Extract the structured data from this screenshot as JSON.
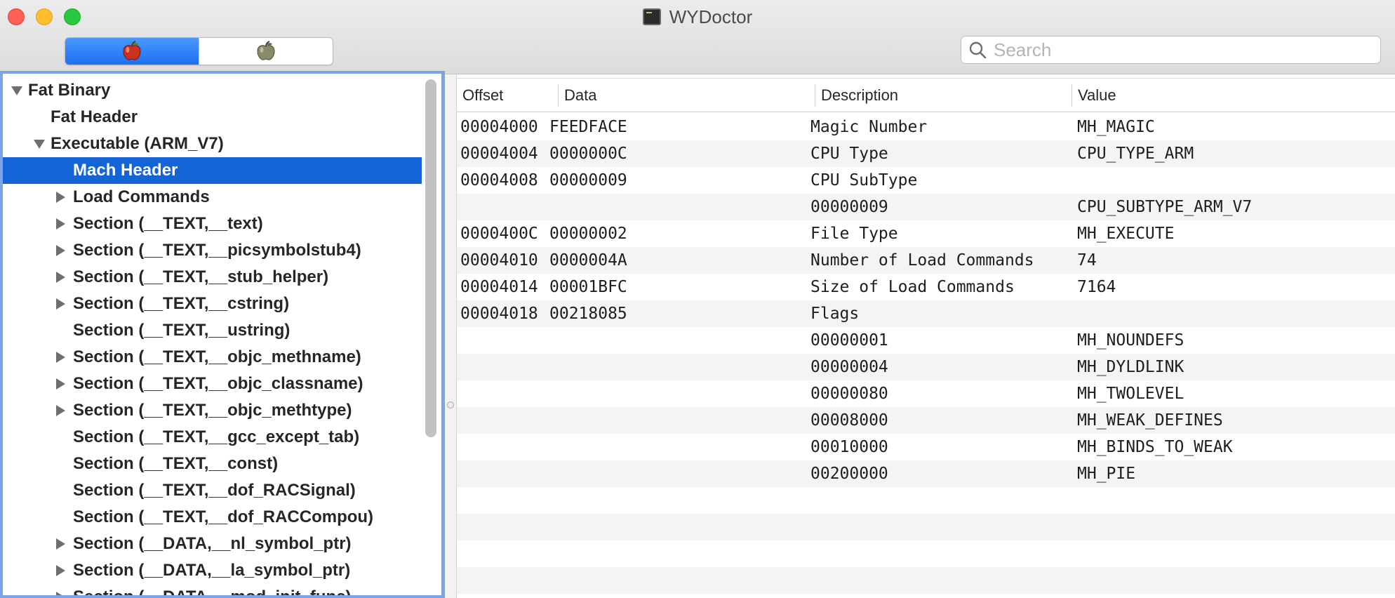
{
  "window": {
    "title": "WYDoctor"
  },
  "search": {
    "placeholder": "Search",
    "value": ""
  },
  "segmented": {
    "items": [
      {
        "icon": "red-apple-icon",
        "selected": true
      },
      {
        "icon": "gray-apple-icon",
        "selected": false
      }
    ]
  },
  "colors": {
    "accent": "#1464d8",
    "segment_active": "#2a7bf4",
    "sidebar_border": "#7aa6e8"
  },
  "tree": {
    "items": [
      {
        "label": "Fat Binary",
        "level": 0,
        "disclosure": "open"
      },
      {
        "label": "Fat Header",
        "level": 1,
        "disclosure": "none"
      },
      {
        "label": "Executable  (ARM_V7)",
        "level": 1,
        "disclosure": "open"
      },
      {
        "label": "Mach Header",
        "level": 2,
        "disclosure": "none",
        "selected": true
      },
      {
        "label": "Load Commands",
        "level": 2,
        "disclosure": "closed"
      },
      {
        "label": "Section (__TEXT,__text)",
        "level": 2,
        "disclosure": "closed"
      },
      {
        "label": "Section (__TEXT,__picsymbolstub4)",
        "level": 2,
        "disclosure": "closed"
      },
      {
        "label": "Section (__TEXT,__stub_helper)",
        "level": 2,
        "disclosure": "closed"
      },
      {
        "label": "Section (__TEXT,__cstring)",
        "level": 2,
        "disclosure": "closed"
      },
      {
        "label": "Section (__TEXT,__ustring)",
        "level": 2,
        "disclosure": "none"
      },
      {
        "label": "Section (__TEXT,__objc_methname)",
        "level": 2,
        "disclosure": "closed"
      },
      {
        "label": "Section (__TEXT,__objc_classname)",
        "level": 2,
        "disclosure": "closed"
      },
      {
        "label": "Section (__TEXT,__objc_methtype)",
        "level": 2,
        "disclosure": "closed"
      },
      {
        "label": "Section (__TEXT,__gcc_except_tab)",
        "level": 2,
        "disclosure": "none"
      },
      {
        "label": "Section (__TEXT,__const)",
        "level": 2,
        "disclosure": "none"
      },
      {
        "label": "Section (__TEXT,__dof_RACSignal)",
        "level": 2,
        "disclosure": "none"
      },
      {
        "label": "Section (__TEXT,__dof_RACCompou)",
        "level": 2,
        "disclosure": "none"
      },
      {
        "label": "Section (__DATA,__nl_symbol_ptr)",
        "level": 2,
        "disclosure": "closed"
      },
      {
        "label": "Section (__DATA,__la_symbol_ptr)",
        "level": 2,
        "disclosure": "closed"
      },
      {
        "label": "Section (__DATA,__mod_init_func)",
        "level": 2,
        "disclosure": "closed"
      }
    ]
  },
  "table": {
    "columns": [
      "Offset",
      "Data",
      "Description",
      "Value"
    ],
    "rows": [
      [
        "00004000",
        "FEEDFACE",
        "Magic Number",
        "MH_MAGIC"
      ],
      [
        "00004004",
        "0000000C",
        "CPU Type",
        "CPU_TYPE_ARM"
      ],
      [
        "00004008",
        "00000009",
        "CPU SubType",
        ""
      ],
      [
        "",
        "",
        "00000009",
        "CPU_SUBTYPE_ARM_V7"
      ],
      [
        "0000400C",
        "00000002",
        "File Type",
        "MH_EXECUTE"
      ],
      [
        "00004010",
        "0000004A",
        "Number of Load Commands",
        "74"
      ],
      [
        "00004014",
        "00001BFC",
        "Size of Load Commands",
        "7164"
      ],
      [
        "00004018",
        "00218085",
        "Flags",
        ""
      ],
      [
        "",
        "",
        "00000001",
        "MH_NOUNDEFS"
      ],
      [
        "",
        "",
        "00000004",
        "MH_DYLDLINK"
      ],
      [
        "",
        "",
        "00000080",
        "MH_TWOLEVEL"
      ],
      [
        "",
        "",
        "00008000",
        "MH_WEAK_DEFINES"
      ],
      [
        "",
        "",
        "00010000",
        "MH_BINDS_TO_WEAK"
      ],
      [
        "",
        "",
        "00200000",
        "MH_PIE"
      ]
    ]
  }
}
